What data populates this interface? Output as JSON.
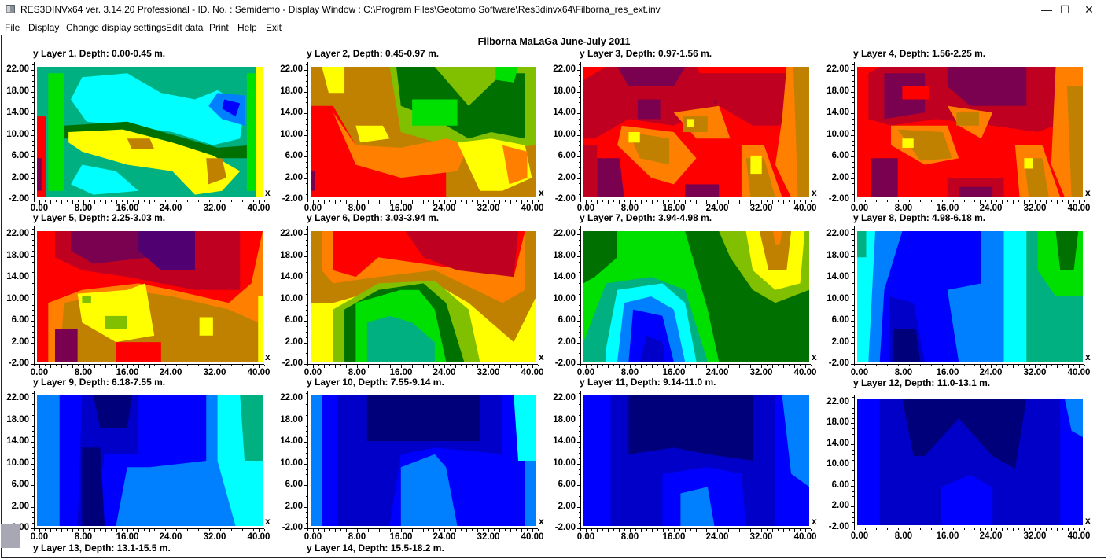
{
  "window": {
    "title": "RES3DINVx64 ver. 3.14.20 Professional - ID. No. : Semidemo  - Display Window : C:\\Program Files\\Geotomo Software\\Res3dinvx64\\Filborna_res_ext.inv",
    "controls": {
      "minimize": "—",
      "maximize": "☐",
      "close": "✕"
    }
  },
  "menu": [
    "File",
    "Display",
    "Change display settings",
    "Edit data",
    "Print",
    "Help",
    "Exit"
  ],
  "display": {
    "title": "Filborna MaLaGa June-July 2011",
    "y_axis_name": "y",
    "x_axis_name": "x",
    "y_ticks": [
      "22.00",
      "18.00",
      "14.00",
      "10.00",
      "6.00",
      "2.00",
      "-2.00"
    ],
    "x_ticks": [
      "0.00",
      "8.00",
      "16.00",
      "24.00",
      "32.00",
      "40.00"
    ],
    "layers": [
      {
        "label": "Layer 1, Depth: 0.00-0.45 m."
      },
      {
        "label": "Layer 2, Depth: 0.45-0.97 m."
      },
      {
        "label": "Layer 3, Depth: 0.97-1.56 m."
      },
      {
        "label": "Layer 4, Depth: 1.56-2.25 m."
      },
      {
        "label": "Layer 5, Depth: 2.25-3.03 m."
      },
      {
        "label": "Layer 6, Depth: 3.03-3.94 m."
      },
      {
        "label": "Layer 7, Depth: 3.94-4.98 m."
      },
      {
        "label": "Layer 8, Depth: 4.98-6.18 m."
      },
      {
        "label": "Layer 9, Depth: 6.18-7.55 m."
      },
      {
        "label": "Layer 10, Depth: 7.55-9.14 m."
      },
      {
        "label": "Layer 11, Depth: 9.14-11.0 m."
      },
      {
        "label": "Layer 12, Depth: 11.0-13.1 m."
      },
      {
        "label": "Layer 13, Depth: 13.1-15.5 m."
      },
      {
        "label": "Layer 14, Depth: 15.5-18.2 m."
      }
    ]
  },
  "chart_data": {
    "type": "heatmap",
    "title": "Filborna MaLaGa June-July 2011",
    "xlabel": "x",
    "ylabel": "y",
    "xlim": [
      -1,
      41
    ],
    "ylim": [
      -2,
      23.5
    ],
    "x_tick_labels": [
      "0.00",
      "8.00",
      "16.00",
      "24.00",
      "32.00",
      "40.00"
    ],
    "y_tick_labels": [
      "22.00",
      "18.00",
      "14.00",
      "10.00",
      "6.00",
      "2.00",
      "-2.00"
    ],
    "grid": false,
    "panels": [
      "Layer 1, Depth: 0.00-0.45 m.",
      "Layer 2, Depth: 0.45-0.97 m.",
      "Layer 3, Depth: 0.97-1.56 m.",
      "Layer 4, Depth: 1.56-2.25 m.",
      "Layer 5, Depth: 2.25-3.03 m.",
      "Layer 6, Depth: 3.03-3.94 m.",
      "Layer 7, Depth: 3.94-4.98 m.",
      "Layer 8, Depth: 4.98-6.18 m.",
      "Layer 9, Depth: 6.18-7.55 m.",
      "Layer 10, Depth: 7.55-9.14 m.",
      "Layer 11, Depth: 9.14-11.0 m.",
      "Layer 12, Depth: 11.0-13.1 m."
    ],
    "color_scale": [
      "#00007a",
      "#0000c8",
      "#0000ff",
      "#0080ff",
      "#00ffff",
      "#00b080",
      "#007000",
      "#00e000",
      "#80c000",
      "#ffff00",
      "#c08000",
      "#ff8000",
      "#ff0000",
      "#c00020",
      "#7a0050",
      "#500070"
    ]
  }
}
